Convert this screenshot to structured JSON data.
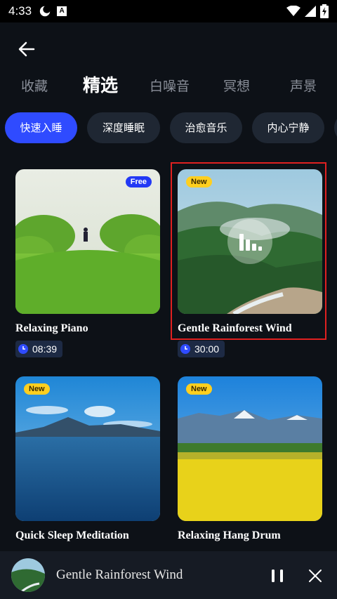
{
  "status_bar": {
    "time": "4:33",
    "notification_icons": [
      "moon-icon",
      "a-badge-icon"
    ],
    "system_icons": [
      "wifi-icon",
      "signal-icon",
      "battery-charging-icon"
    ]
  },
  "header": {
    "back_icon": "arrow-left-icon",
    "tabs": [
      {
        "label": "收藏",
        "active": false
      },
      {
        "label": "精选",
        "active": true
      },
      {
        "label": "白噪音",
        "active": false
      },
      {
        "label": "冥想",
        "active": false
      },
      {
        "label": "声景",
        "active": false
      }
    ]
  },
  "chips": [
    {
      "label": "快速入睡",
      "active": true
    },
    {
      "label": "深度睡眠",
      "active": false
    },
    {
      "label": "治愈音乐",
      "active": false
    },
    {
      "label": "内心宁静",
      "active": false
    }
  ],
  "cards": [
    {
      "title": "Relaxing Piano",
      "badge": "Free",
      "duration": "08:39",
      "icon": "clock-icon"
    },
    {
      "title": "Gentle Rainforest Wind",
      "badge": "New",
      "duration": "30:00",
      "icon": "clock-icon",
      "playing": true
    },
    {
      "title": "Quick Sleep Meditation",
      "badge": "New"
    },
    {
      "title": "Relaxing Hang Drum",
      "badge": "New"
    }
  ],
  "player": {
    "title": "Gentle Rainforest Wind",
    "pause_icon": "pause-icon",
    "close_icon": "close-icon"
  },
  "colors": {
    "background": "#0d1117",
    "chip": "#1f2733",
    "chip_active": "#2f4bff",
    "badge_free": "#2339f5",
    "badge_new": "#ffcf1f",
    "selection_outline": "#e02020"
  }
}
